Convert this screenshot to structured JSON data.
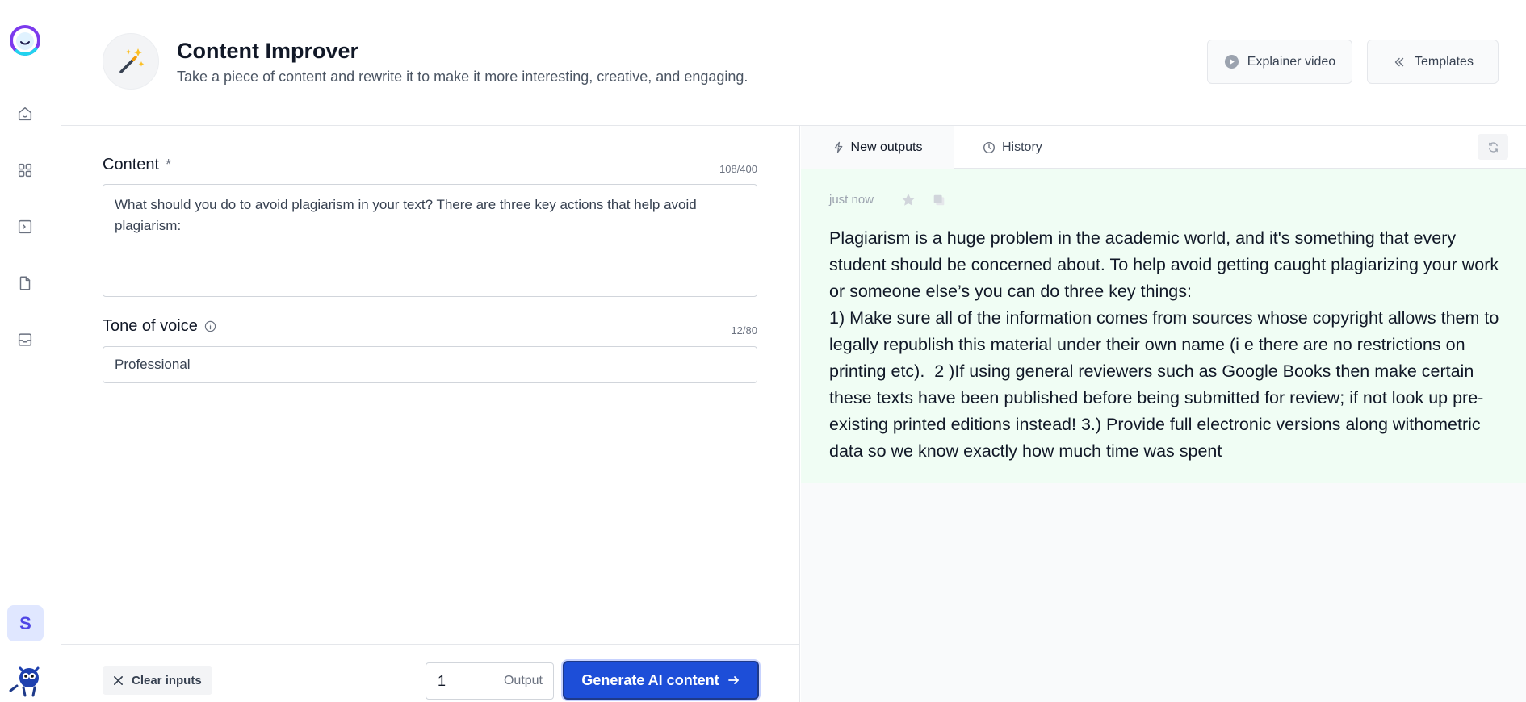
{
  "header": {
    "title": "Content Improver",
    "subtitle": "Take a piece of content and rewrite it to make it more interesting, creative, and engaging.",
    "explainer_label": "Explainer video",
    "templates_label": "Templates"
  },
  "sidebar": {
    "avatar_initial": "S",
    "items": [
      {
        "icon": "home-icon"
      },
      {
        "icon": "grid-icon"
      },
      {
        "icon": "terminal-icon"
      },
      {
        "icon": "document-icon"
      },
      {
        "icon": "inbox-icon"
      }
    ]
  },
  "form": {
    "content": {
      "label": "Content",
      "required_mark": "*",
      "counter": "108/400",
      "value": "What should you do to avoid plagiarism in your text? There are three key actions that help avoid plagiarism:"
    },
    "tone": {
      "label": "Tone of voice",
      "counter": "12/80",
      "value": "Professional"
    },
    "footer": {
      "clear_label": "Clear inputs",
      "output_count": "1",
      "output_label": "Output",
      "generate_label": "Generate AI content"
    }
  },
  "output": {
    "tabs": [
      {
        "label": "New outputs",
        "icon": "bolt-icon",
        "active": true
      },
      {
        "label": "History",
        "icon": "clock-icon",
        "active": false
      }
    ],
    "result": {
      "time": "just now",
      "text": "Plagiarism is a huge problem in the academic world, and it's something that every student should be concerned about. To help avoid getting caught plagiarizing your work or someone else’s you can do three key things:\n1) Make sure all of the information comes from sources whose copyright allows them to legally republish this material under their own name (i e there are no restrictions on printing etc).  2 )If using general reviewers such as Google Books then make certain these texts have been published before being submitted for review; if not look up pre-existing printed editions instead! 3.) Provide full electronic versions along withometric data so we know exactly how much time was spent"
    }
  },
  "colors": {
    "accent": "#1d4ed8",
    "output_bg": "#f0fdf4",
    "brand_purple": "#6d28d9"
  }
}
